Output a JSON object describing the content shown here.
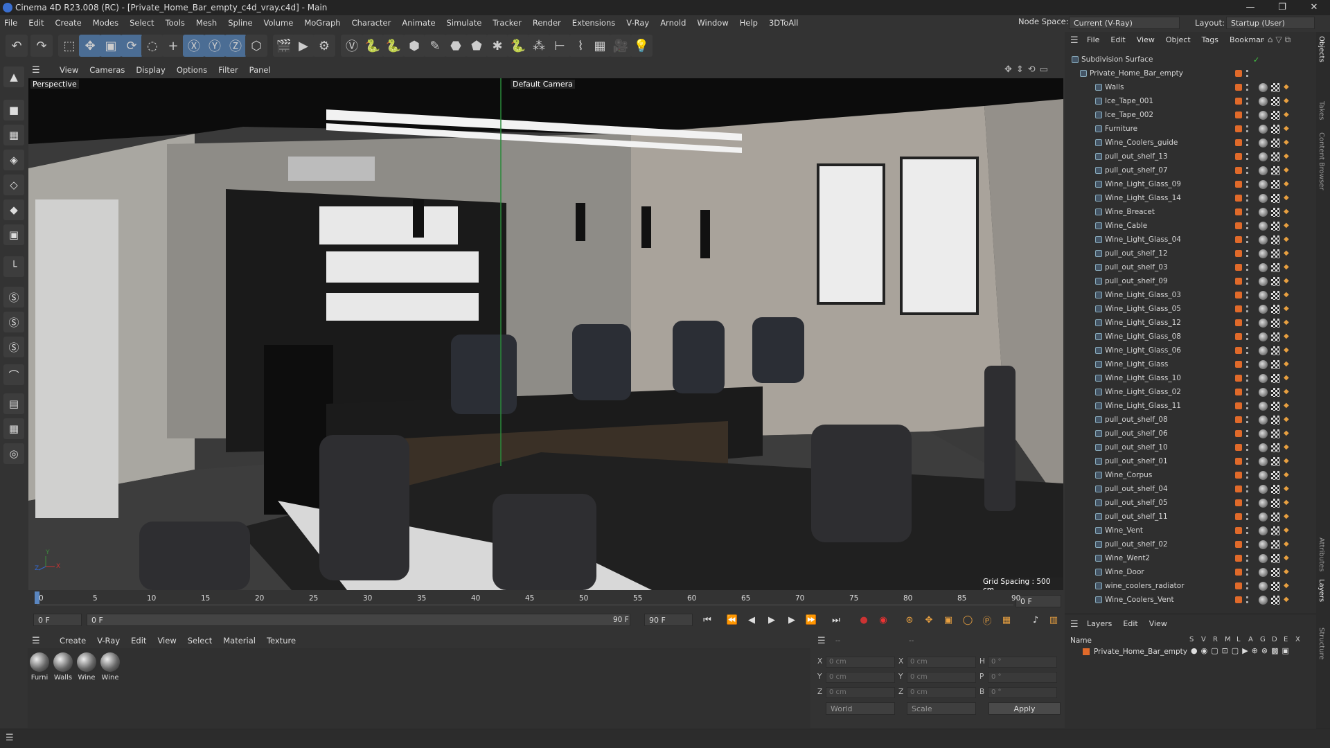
{
  "window": {
    "title": "Cinema 4D R23.008 (RC) - [Private_Home_Bar_empty_c4d_vray.c4d] - Main",
    "minimize": "—",
    "restore": "❐",
    "close": "✕"
  },
  "menubar": [
    "File",
    "Edit",
    "Create",
    "Modes",
    "Select",
    "Tools",
    "Mesh",
    "Spline",
    "Volume",
    "MoGraph",
    "Character",
    "Animate",
    "Simulate",
    "Tracker",
    "Render",
    "Extensions",
    "V-Ray",
    "Arnold",
    "Window",
    "Help",
    "3DToAll"
  ],
  "node_space": {
    "label": "Node Space:",
    "value": "Current (V-Ray)"
  },
  "layout": {
    "label": "Layout:",
    "value": "Startup (User)"
  },
  "toolbar_icons": [
    "undo-icon",
    "redo-icon",
    "live-selection-icon",
    "move-icon",
    "scale-icon",
    "rotate-icon",
    "recent-tool-icon",
    "add-icon",
    "x-axis-icon",
    "y-axis-icon",
    "z-axis-icon",
    "coordinate-system-icon",
    "render-region-icon",
    "render-view-icon",
    "render-settings-icon",
    "vray-icon",
    "python-icon",
    "python-icon",
    "cube-icon",
    "pen-icon",
    "subdivision-icon",
    "extrude-icon",
    "array-icon",
    "python-icon",
    "cloner-icon",
    "symmetry-icon",
    "deformer-icon",
    "floor-icon",
    "camera-icon",
    "light-icon"
  ],
  "axis": {
    "x": "X",
    "y": "Y",
    "z": "Z"
  },
  "viewport": {
    "menu": [
      "View",
      "Cameras",
      "Display",
      "Options",
      "Filter",
      "Panel"
    ],
    "label": "Perspective",
    "camera": "Default Camera",
    "grid": "Grid Spacing : 500 cm"
  },
  "timeline": {
    "ticks": [
      "0",
      "5",
      "10",
      "15",
      "20",
      "25",
      "30",
      "35",
      "40",
      "45",
      "50",
      "55",
      "60",
      "65",
      "70",
      "75",
      "80",
      "85",
      "90"
    ],
    "frame_end": "0 F"
  },
  "transport": {
    "start": "0 F",
    "current": "0 F",
    "end": "90 F",
    "max": "90 F"
  },
  "material_menu": [
    "Create",
    "V-Ray",
    "Edit",
    "View",
    "Select",
    "Material",
    "Texture"
  ],
  "materials": [
    "Furni",
    "Walls",
    "Wine",
    "Wine"
  ],
  "coords": {
    "labels": [
      "X",
      "Y",
      "Z",
      "X",
      "Y",
      "Z",
      "H",
      "P",
      "B"
    ],
    "values": [
      "0 cm",
      "0 cm",
      "0 cm",
      "0 cm",
      "0 cm",
      "0 cm",
      "0 °",
      "0 °",
      "0 °"
    ],
    "world": "World",
    "scale": "Scale",
    "apply": "Apply",
    "dash1": "--",
    "dash2": "--"
  },
  "objects_menu": [
    "File",
    "Edit",
    "View",
    "Object",
    "Tags",
    "Bookmar"
  ],
  "objects": [
    {
      "name": "Subdivision Surface",
      "level": 0
    },
    {
      "name": "Private_Home_Bar_empty",
      "level": 1
    },
    {
      "name": "Walls",
      "level": 2
    },
    {
      "name": "Ice_Tape_001",
      "level": 2
    },
    {
      "name": "Ice_Tape_002",
      "level": 2
    },
    {
      "name": "Furniture",
      "level": 2
    },
    {
      "name": "Wine_Coolers_guide",
      "level": 2
    },
    {
      "name": "pull_out_shelf_13",
      "level": 2
    },
    {
      "name": "pull_out_shelf_07",
      "level": 2
    },
    {
      "name": "Wine_Light_Glass_09",
      "level": 2
    },
    {
      "name": "Wine_Light_Glass_14",
      "level": 2
    },
    {
      "name": "Wine_Breacet",
      "level": 2
    },
    {
      "name": "Wine_Cable",
      "level": 2
    },
    {
      "name": "Wine_Light_Glass_04",
      "level": 2
    },
    {
      "name": "pull_out_shelf_12",
      "level": 2
    },
    {
      "name": "pull_out_shelf_03",
      "level": 2
    },
    {
      "name": "pull_out_shelf_09",
      "level": 2
    },
    {
      "name": "Wine_Light_Glass_03",
      "level": 2
    },
    {
      "name": "Wine_Light_Glass_05",
      "level": 2
    },
    {
      "name": "Wine_Light_Glass_12",
      "level": 2
    },
    {
      "name": "Wine_Light_Glass_08",
      "level": 2
    },
    {
      "name": "Wine_Light_Glass_06",
      "level": 2
    },
    {
      "name": "Wine_Light_Glass",
      "level": 2
    },
    {
      "name": "Wine_Light_Glass_10",
      "level": 2
    },
    {
      "name": "Wine_Light_Glass_02",
      "level": 2
    },
    {
      "name": "Wine_Light_Glass_11",
      "level": 2
    },
    {
      "name": "pull_out_shelf_08",
      "level": 2
    },
    {
      "name": "pull_out_shelf_06",
      "level": 2
    },
    {
      "name": "pull_out_shelf_10",
      "level": 2
    },
    {
      "name": "pull_out_shelf_01",
      "level": 2
    },
    {
      "name": "Wine_Corpus",
      "level": 2
    },
    {
      "name": "pull_out_shelf_04",
      "level": 2
    },
    {
      "name": "pull_out_shelf_05",
      "level": 2
    },
    {
      "name": "pull_out_shelf_11",
      "level": 2
    },
    {
      "name": "Wine_Vent",
      "level": 2
    },
    {
      "name": "pull_out_shelf_02",
      "level": 2
    },
    {
      "name": "Wine_Went2",
      "level": 2
    },
    {
      "name": "Wine_Door",
      "level": 2
    },
    {
      "name": "wine_coolers_radiator",
      "level": 2
    },
    {
      "name": "Wine_Coolers_Vent",
      "level": 2
    }
  ],
  "layers": {
    "menu": [
      "Layers",
      "Edit",
      "View"
    ],
    "header": "Name",
    "cols": [
      "S",
      "V",
      "R",
      "M",
      "L",
      "A",
      "G",
      "D",
      "E",
      "X"
    ],
    "row": "Private_Home_Bar_empty"
  },
  "side_tabs": [
    "Objects",
    "Takes",
    "Content Browser",
    "Attributes",
    "Layers",
    "Structure"
  ]
}
